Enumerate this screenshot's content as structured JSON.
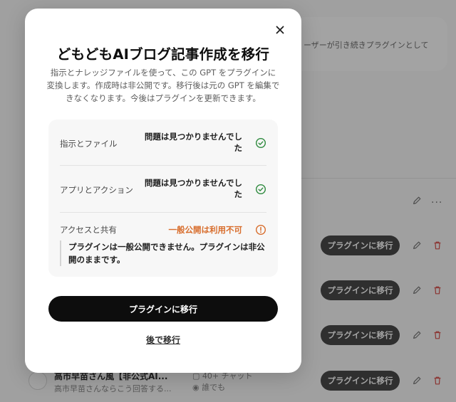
{
  "background": {
    "banner_text": "ーザーが引き続きプラグインとして",
    "pill_label": "プラグインに移行",
    "more_glyph": "···",
    "gpt_item": {
      "title": "高市早苗さん風【非公式AI...",
      "description": "高市早苗さんならこう回答する...",
      "chats": "40+ チャット",
      "visibility": "誰でも"
    }
  },
  "modal": {
    "title": "どもどもAIブログ記事作成を移行",
    "description": "指示とナレッジファイルを使って、この GPT をプラグインに変換します。作成時は非公開です。移行後は元の GPT を編集できなくなります。今後はプラグインを更新できます。",
    "checks": [
      {
        "label": "指示とファイル",
        "status": "問題は見つかりませんでした"
      },
      {
        "label": "アプリとアクション",
        "status": "問題は見つかりませんでした"
      },
      {
        "label": "アクセスと共有",
        "status": "一般公開は利用不可"
      }
    ],
    "access_note": "プラグインは一般公開できません。プラグインは非公開のままです。",
    "primary_button": "プラグインに移行",
    "later_link": "後で移行"
  },
  "colors": {
    "ok": "#2e8a3e",
    "warn": "#d86d2c",
    "primary": "#0d0d0d"
  }
}
